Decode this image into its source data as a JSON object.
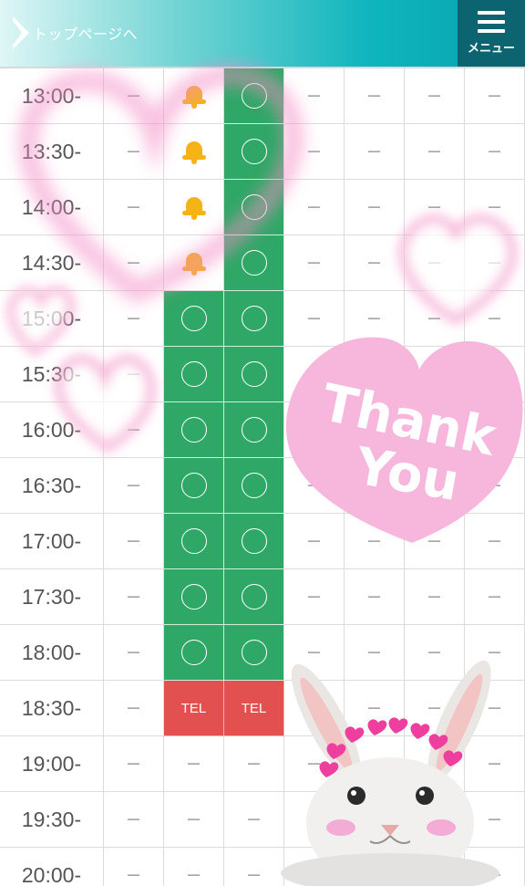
{
  "header": {
    "back_label": "トップページへ",
    "menu_label": "メニュー"
  },
  "schedule": {
    "rows": [
      {
        "time": "13:00-",
        "cells": [
          "dash",
          "bell",
          "ok",
          "dash",
          "dash",
          "dash",
          "dash"
        ]
      },
      {
        "time": "13:30-",
        "cells": [
          "dash",
          "bell",
          "ok",
          "dash",
          "dash",
          "dash",
          "dash"
        ]
      },
      {
        "time": "14:00-",
        "cells": [
          "dash",
          "bell",
          "ok",
          "dash",
          "dash",
          "dash",
          "dash"
        ]
      },
      {
        "time": "14:30-",
        "cells": [
          "dash",
          "bell",
          "ok",
          "dash",
          "dash",
          "dash",
          "dash"
        ]
      },
      {
        "time": "15:00-",
        "cells": [
          "dash",
          "ok",
          "ok",
          "dash",
          "dash",
          "dash",
          "dash"
        ]
      },
      {
        "time": "15:30-",
        "cells": [
          "dash",
          "ok",
          "ok",
          "dash",
          "dash",
          "dash",
          "dash"
        ]
      },
      {
        "time": "16:00-",
        "cells": [
          "dash",
          "ok",
          "ok",
          "dash",
          "dash",
          "dash",
          "dash"
        ]
      },
      {
        "time": "16:30-",
        "cells": [
          "dash",
          "ok",
          "ok",
          "dash",
          "dash",
          "dash",
          "dash"
        ]
      },
      {
        "time": "17:00-",
        "cells": [
          "dash",
          "ok",
          "ok",
          "dash",
          "dash",
          "dash",
          "dash"
        ]
      },
      {
        "time": "17:30-",
        "cells": [
          "dash",
          "ok",
          "ok",
          "dash",
          "dash",
          "dash",
          "dash"
        ]
      },
      {
        "time": "18:00-",
        "cells": [
          "dash",
          "ok",
          "ok",
          "dash",
          "dash",
          "dash",
          "dash"
        ]
      },
      {
        "time": "18:30-",
        "cells": [
          "dash",
          "tel",
          "tel",
          "dash",
          "dash",
          "dash",
          "dash"
        ]
      },
      {
        "time": "19:00-",
        "cells": [
          "dash",
          "dash",
          "dash",
          "dash",
          "dash",
          "dash",
          "dash"
        ]
      },
      {
        "time": "19:30-",
        "cells": [
          "dash",
          "dash",
          "dash",
          "dash",
          "dash",
          "dash",
          "dash"
        ]
      },
      {
        "time": "20:00-",
        "cells": [
          "dash",
          "dash",
          "dash",
          "dash",
          "dash",
          "dash",
          "dash"
        ]
      }
    ],
    "dash_text": "－",
    "tel_text": "TEL",
    "icons": {
      "dash": "dash",
      "bell": "bell-icon",
      "ok": "available-circle-icon",
      "tel": "tel-label"
    }
  },
  "stamp": {
    "text_line1": "Thank",
    "text_line2": "You",
    "heart_color": "#f7b6dc"
  },
  "colors": {
    "available": "#2fa766",
    "tel": "#e2504f",
    "bell": "#f5b315",
    "menu_bg": "#0c6470"
  }
}
